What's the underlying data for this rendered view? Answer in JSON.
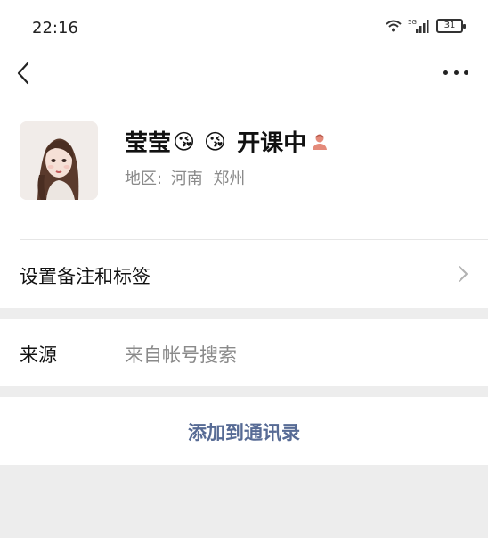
{
  "status_bar": {
    "time": "22:16",
    "network": "5G",
    "battery": "31"
  },
  "nav": {
    "back_icon": "chevron-left-icon",
    "more_icon": "more-horizontal-icon"
  },
  "profile": {
    "name": "莹莹",
    "emoji_1": "😘",
    "emoji_2": "😘",
    "status_text": "开课中",
    "status_icon": "teacher-icon",
    "region_label": "地区:",
    "region_value": "河南  郑州"
  },
  "tags_row": {
    "label": "设置备注和标签"
  },
  "source_row": {
    "label": "来源",
    "value": "来自帐号搜索"
  },
  "add_contact": {
    "label": "添加到通讯录"
  },
  "colors": {
    "link": "#576b95",
    "secondary_text": "#8a8a8a",
    "background": "#ededed"
  }
}
